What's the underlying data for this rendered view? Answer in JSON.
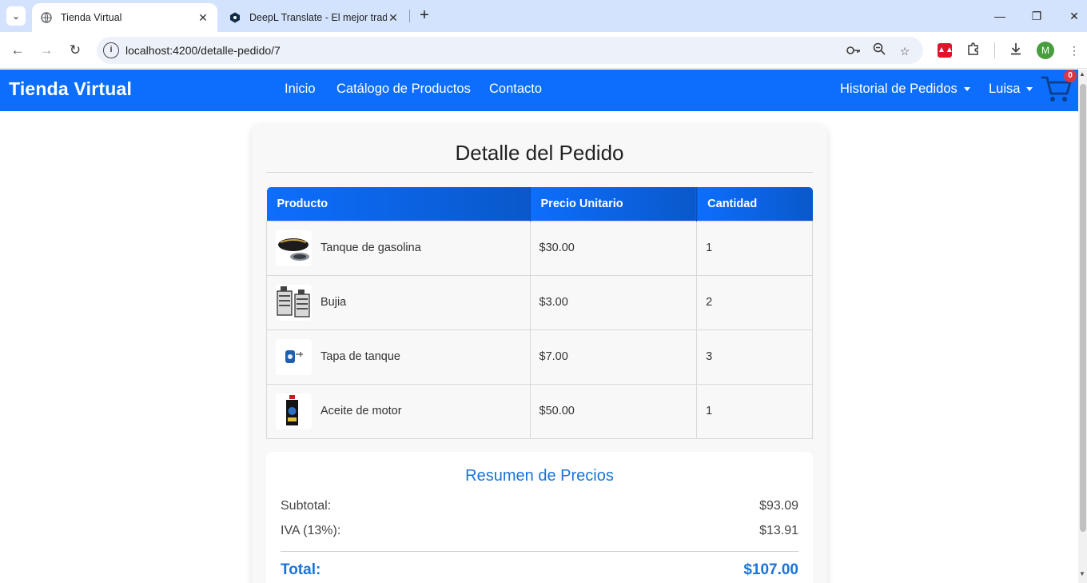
{
  "browser": {
    "tabs": [
      {
        "title": "Tienda Virtual",
        "active": true
      },
      {
        "title": "DeepL Translate - El mejor traductor",
        "active": false
      }
    ],
    "url": "localhost:4200/detalle-pedido/7",
    "profile_initial": "M",
    "icons": [
      "tab-search-icon",
      "globe-icon",
      "deepl-icon",
      "close-icon",
      "plus-icon",
      "minimize-icon",
      "restore-icon",
      "back-icon",
      "forward-icon",
      "reload-icon",
      "site-info-icon",
      "password-key-icon",
      "zoom-icon",
      "bookmark-star-icon",
      "extension-puzzle-icon",
      "download-icon",
      "kebab-menu-icon"
    ]
  },
  "navbar": {
    "brand": "Tienda Virtual",
    "links": [
      "Inicio",
      "Catálogo de Productos",
      "Contacto"
    ],
    "history_menu": "Historial de Pedidos",
    "user_menu": "Luisa",
    "cart_count": "0",
    "accent": "#0d6efd"
  },
  "order": {
    "title": "Detalle del Pedido",
    "columns": [
      "Producto",
      "Precio Unitario",
      "Cantidad"
    ],
    "items": [
      {
        "name": "Tanque de gasolina",
        "price": "$30.00",
        "qty": "1",
        "image": "fuel-tank-image"
      },
      {
        "name": "Bujia",
        "price": "$3.00",
        "qty": "2",
        "image": "spark-plug-image"
      },
      {
        "name": "Tapa de tanque",
        "price": "$7.00",
        "qty": "3",
        "image": "tank-cap-image"
      },
      {
        "name": "Aceite de motor",
        "price": "$50.00",
        "qty": "1",
        "image": "motor-oil-image"
      }
    ]
  },
  "summary": {
    "title": "Resumen de Precios",
    "subtotal_label": "Subtotal:",
    "subtotal_value": "$93.09",
    "tax_label": "IVA (13%):",
    "tax_value": "$13.91",
    "total_label": "Total:",
    "total_value": "$107.00",
    "accent": "#1a73d8"
  }
}
